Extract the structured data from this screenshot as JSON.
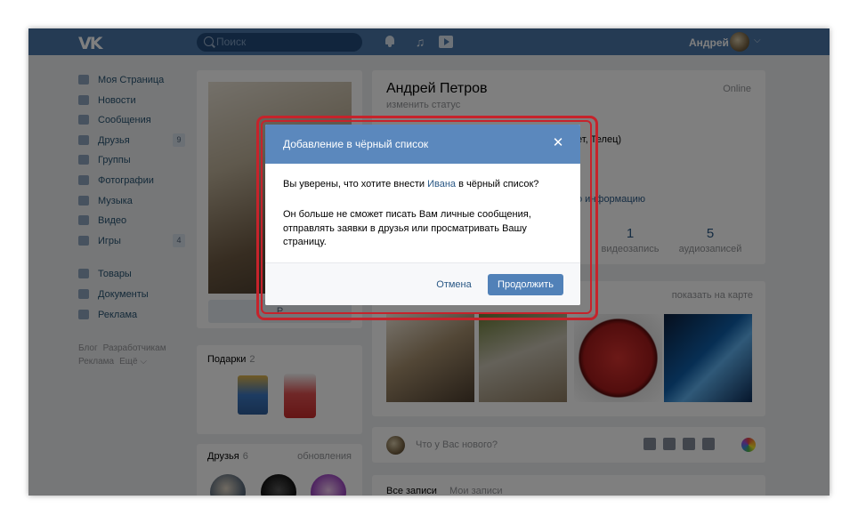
{
  "header": {
    "logo": "VK",
    "search_placeholder": "Поиск",
    "user_name": "Андрей",
    "chevron": "⌵"
  },
  "sidebar": {
    "items": [
      {
        "label": "Моя Страница",
        "icon": "home-icon"
      },
      {
        "label": "Новости",
        "icon": "news-icon"
      },
      {
        "label": "Сообщения",
        "icon": "messages-icon"
      },
      {
        "label": "Друзья",
        "icon": "friends-icon",
        "count": "9"
      },
      {
        "label": "Группы",
        "icon": "groups-icon"
      },
      {
        "label": "Фотографии",
        "icon": "photos-icon"
      },
      {
        "label": "Музыка",
        "icon": "music-icon"
      },
      {
        "label": "Видео",
        "icon": "video-icon"
      },
      {
        "label": "Игры",
        "icon": "games-icon",
        "count": "4"
      }
    ],
    "items2": [
      {
        "label": "Товары",
        "icon": "goods-icon"
      },
      {
        "label": "Документы",
        "icon": "documents-icon"
      },
      {
        "label": "Реклама",
        "icon": "ads-icon"
      }
    ],
    "footer": [
      "Блог",
      "Разработчикам",
      "Реклама",
      "Ещё ⌵"
    ]
  },
  "profile": {
    "name": "Андрей Петров",
    "status": "изменить статус",
    "online": "Online",
    "info_line": "ет, Телец)",
    "more_info": "о информацию",
    "edit_button": "Р",
    "counters": [
      {
        "number": "1",
        "label": "видеозапись"
      },
      {
        "number": "5",
        "label": "аудиозаписей"
      }
    ]
  },
  "gifts": {
    "title": "Подарки",
    "count": "2"
  },
  "friends": {
    "title": "Друзья",
    "count": "6",
    "updates": "обновления"
  },
  "photos": {
    "show_on_map": "показать на карте"
  },
  "post": {
    "placeholder": "Что у Вас нового?"
  },
  "wall": {
    "tab_all": "Все записи",
    "tab_mine": "Мои записи"
  },
  "modal": {
    "title": "Добавление в чёрный список",
    "question_before": "Вы уверены, что хотите внести ",
    "question_link": "Ивана",
    "question_after": " в чёрный список?",
    "description": "Он больше не сможет писать Вам личные сообщения, отправлять заявки в друзья или просматривать Вашу страницу.",
    "cancel": "Отмена",
    "continue": "Продолжить",
    "close_icon": "✕"
  },
  "colors": {
    "header_bg": "#4a76a8",
    "modal_header": "#5b88bd",
    "primary_button": "#5181b8",
    "highlight_border": "#c6232b",
    "link": "#2a5885"
  }
}
